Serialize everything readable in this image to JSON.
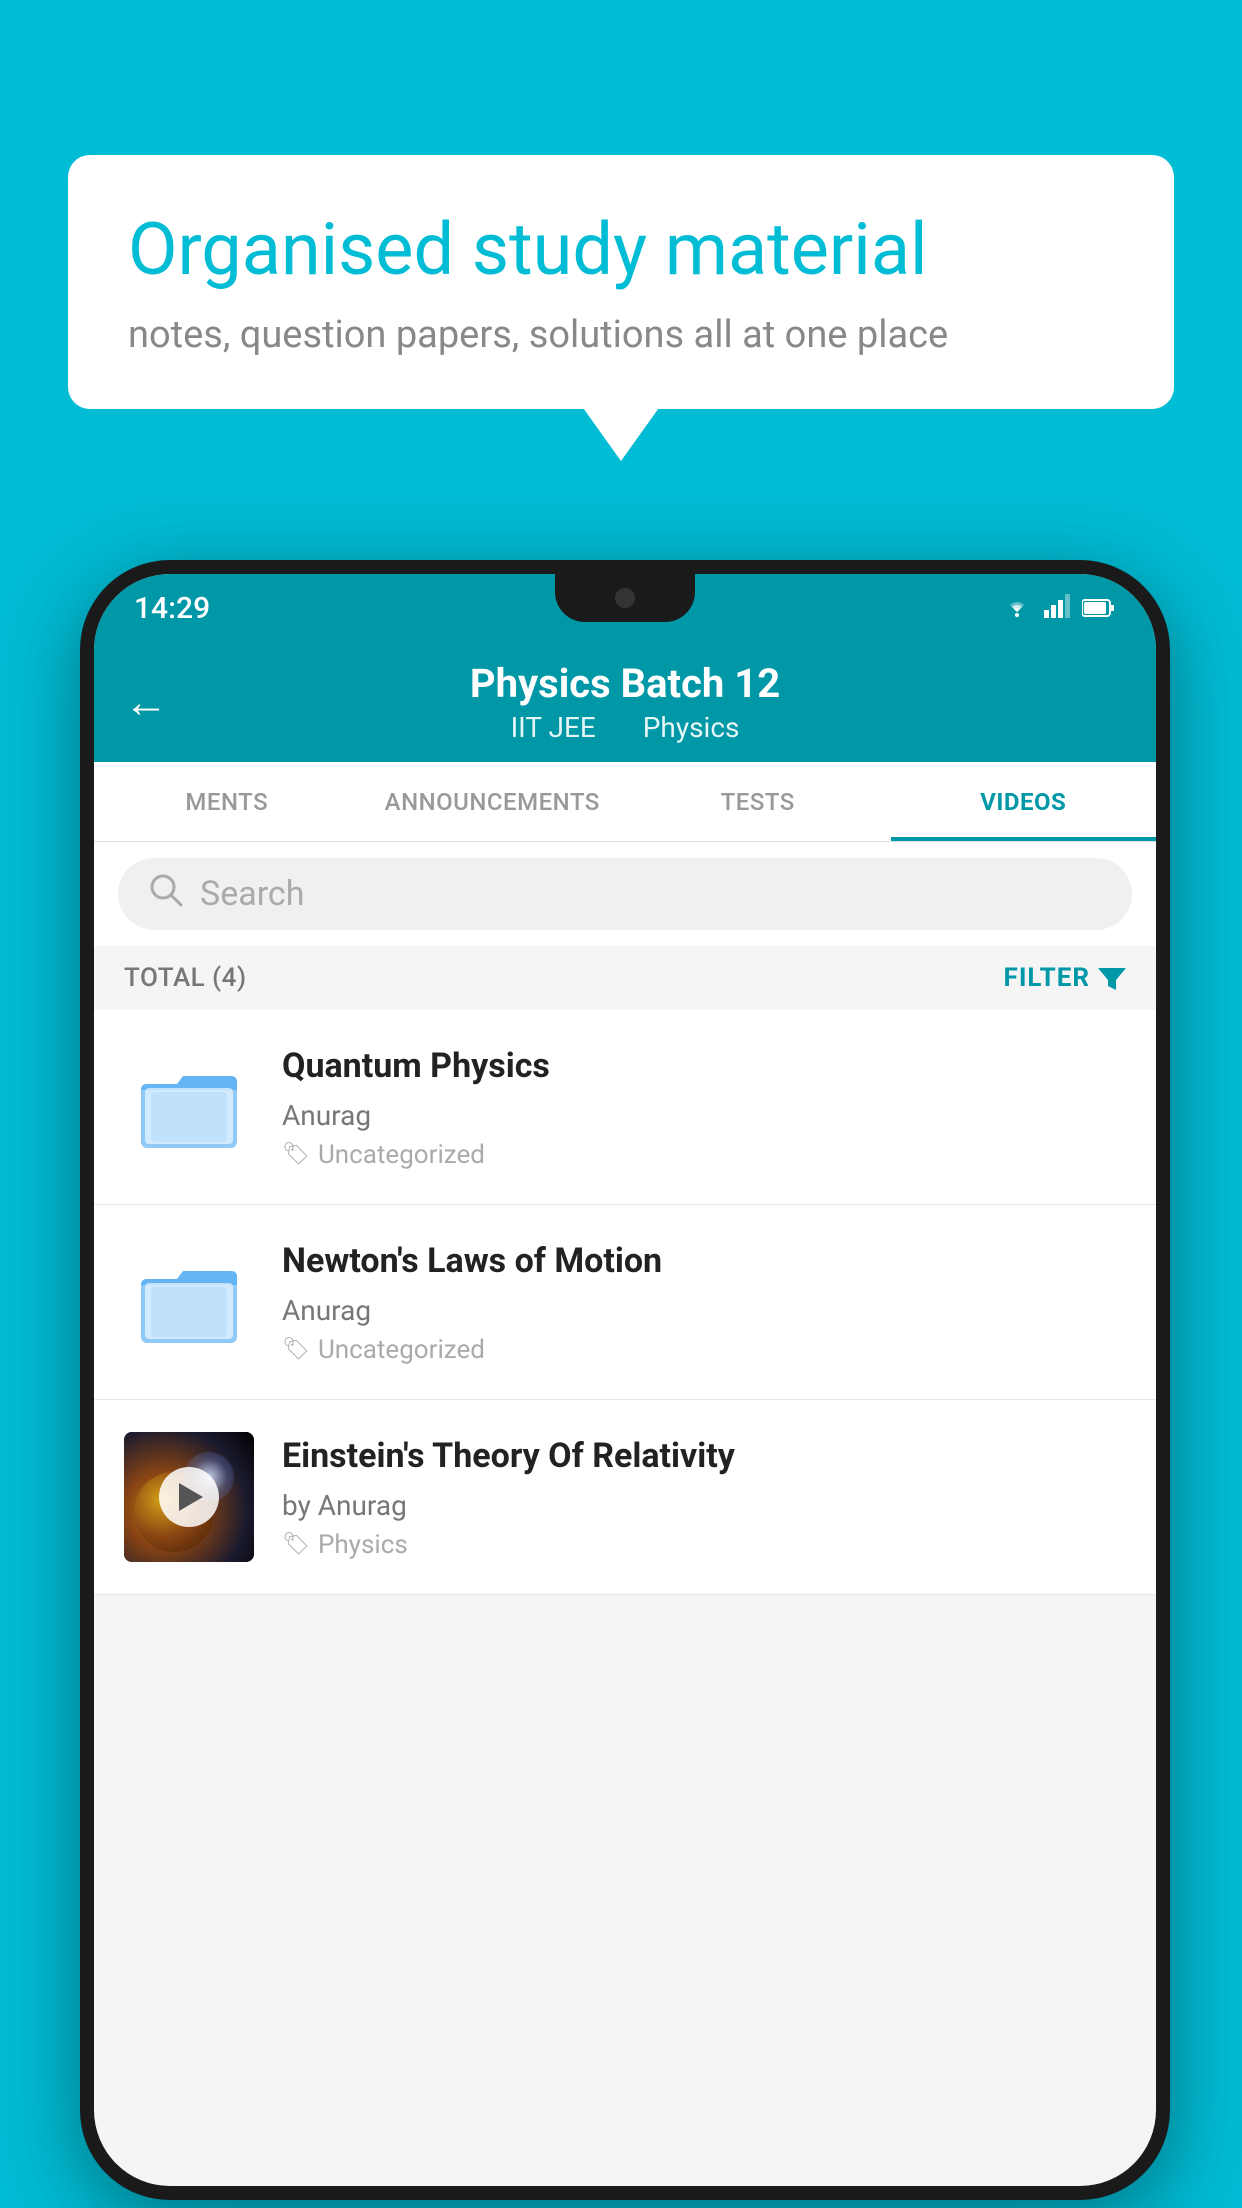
{
  "background_color": "#00BCD4",
  "speech_bubble": {
    "title": "Organised study material",
    "subtitle": "notes, question papers, solutions all at one place"
  },
  "phone": {
    "status_bar": {
      "time": "14:29",
      "wifi": "▾",
      "signal": "▲",
      "battery": "▮"
    },
    "header": {
      "back_label": "←",
      "title": "Physics Batch 12",
      "tag1": "IIT JEE",
      "tag2": "Physics"
    },
    "tabs": [
      {
        "label": "MENTS",
        "active": false
      },
      {
        "label": "ANNOUNCEMENTS",
        "active": false
      },
      {
        "label": "TESTS",
        "active": false
      },
      {
        "label": "VIDEOS",
        "active": true
      }
    ],
    "search": {
      "placeholder": "Search"
    },
    "filter_bar": {
      "total_label": "TOTAL (4)",
      "filter_label": "FILTER"
    },
    "videos": [
      {
        "id": 1,
        "title": "Quantum Physics",
        "author": "Anurag",
        "tag": "Uncategorized",
        "has_thumbnail": false
      },
      {
        "id": 2,
        "title": "Newton's Laws of Motion",
        "author": "Anurag",
        "tag": "Uncategorized",
        "has_thumbnail": false
      },
      {
        "id": 3,
        "title": "Einstein's Theory Of Relativity",
        "author": "by Anurag",
        "tag": "Physics",
        "has_thumbnail": true
      }
    ]
  }
}
